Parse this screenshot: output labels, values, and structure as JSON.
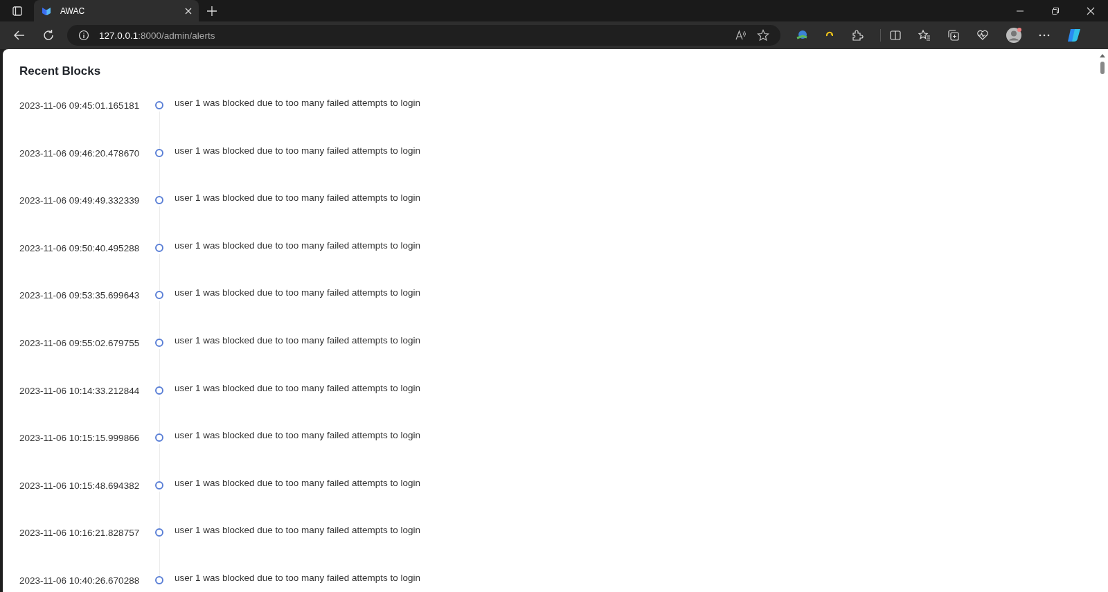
{
  "browser": {
    "tab": {
      "title": "AWAC",
      "selected": true
    },
    "address": {
      "host": "127.0.0.1",
      "rest": ":8000/admin/alerts"
    }
  },
  "page": {
    "title": "Recent Blocks",
    "events": [
      {
        "time": "2023-11-06 09:45:01.165181",
        "message": "user 1 was blocked due to too many failed attempts to login"
      },
      {
        "time": "2023-11-06 09:46:20.478670",
        "message": "user 1 was blocked due to too many failed attempts to login"
      },
      {
        "time": "2023-11-06 09:49:49.332339",
        "message": "user 1 was blocked due to too many failed attempts to login"
      },
      {
        "time": "2023-11-06 09:50:40.495288",
        "message": "user 1 was blocked due to too many failed attempts to login"
      },
      {
        "time": "2023-11-06 09:53:35.699643",
        "message": "user 1 was blocked due to too many failed attempts to login"
      },
      {
        "time": "2023-11-06 09:55:02.679755",
        "message": "user 1 was blocked due to too many failed attempts to login"
      },
      {
        "time": "2023-11-06 10:14:33.212844",
        "message": "user 1 was blocked due to too many failed attempts to login"
      },
      {
        "time": "2023-11-06 10:15:15.999866",
        "message": "user 1 was blocked due to too many failed attempts to login"
      },
      {
        "time": "2023-11-06 10:15:48.694382",
        "message": "user 1 was blocked due to too many failed attempts to login"
      },
      {
        "time": "2023-11-06 10:16:21.828757",
        "message": "user 1 was blocked due to too many failed attempts to login"
      },
      {
        "time": "2023-11-06 10:40:26.670288",
        "message": "user 1 was blocked due to too many failed attempts to login"
      }
    ]
  }
}
